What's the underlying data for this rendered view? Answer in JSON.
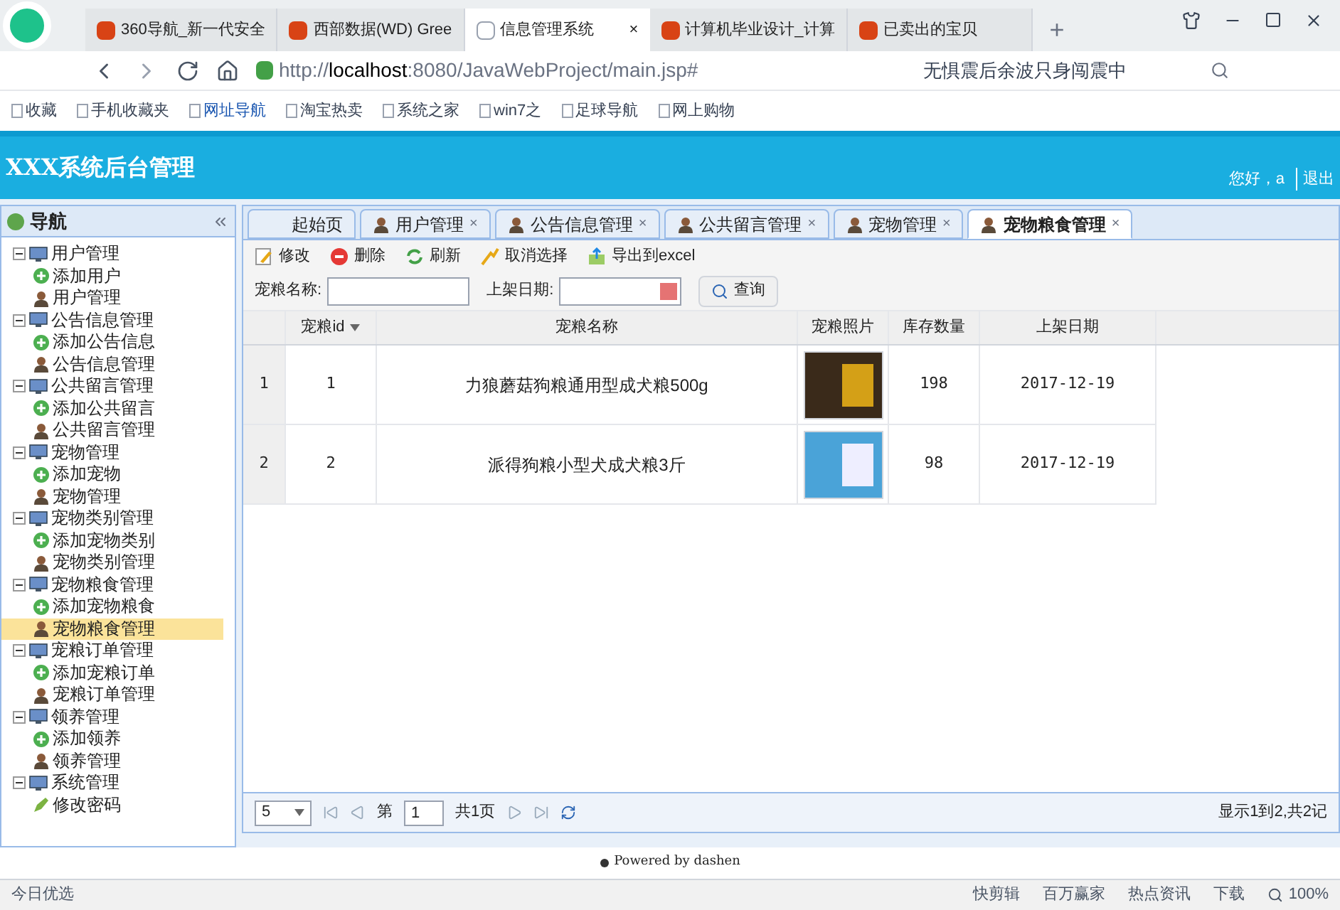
{
  "browser": {
    "tabs": [
      {
        "label": "360导航_新一代安全",
        "selected": false
      },
      {
        "label": "西部数据(WD) Gree",
        "selected": false
      },
      {
        "label": "信息管理系统",
        "selected": true,
        "close": "×"
      },
      {
        "label": "计算机毕业设计_计算",
        "selected": false
      },
      {
        "label": "已卖出的宝贝",
        "selected": false
      }
    ],
    "new_tab": "+",
    "url_host": "http://localhost",
    "url_rest": ":8080/JavaWebProject/main.jsp#",
    "search_hint": "无惧震后余波只身闯震中",
    "bookmarks": [
      "收藏",
      "手机收藏夹",
      "网址导航",
      "淘宝热卖",
      "系统之家",
      "win7之",
      "足球导航",
      "网上购物"
    ]
  },
  "app": {
    "title": "XXX系统后台管理",
    "greeting": "您好，a",
    "logout": "退出"
  },
  "sidebar": {
    "title": "导航",
    "items": [
      {
        "label": "用户管理",
        "children": [
          {
            "label": "添加用户",
            "kind": "add",
            "selected": false
          },
          {
            "label": "用户管理",
            "kind": "manage",
            "selected": false
          }
        ]
      },
      {
        "label": "公告信息管理",
        "children": [
          {
            "label": "添加公告信息",
            "kind": "add",
            "selected": false
          },
          {
            "label": "公告信息管理",
            "kind": "manage",
            "selected": false
          }
        ]
      },
      {
        "label": "公共留言管理",
        "children": [
          {
            "label": "添加公共留言",
            "kind": "add",
            "selected": false
          },
          {
            "label": "公共留言管理",
            "kind": "manage",
            "selected": false
          }
        ]
      },
      {
        "label": "宠物管理",
        "children": [
          {
            "label": "添加宠物",
            "kind": "add",
            "selected": false
          },
          {
            "label": "宠物管理",
            "kind": "manage",
            "selected": false
          }
        ]
      },
      {
        "label": "宠物类别管理",
        "children": [
          {
            "label": "添加宠物类别",
            "kind": "add",
            "selected": false
          },
          {
            "label": "宠物类别管理",
            "kind": "manage",
            "selected": false
          }
        ]
      },
      {
        "label": "宠物粮食管理",
        "children": [
          {
            "label": "添加宠物粮食",
            "kind": "add",
            "selected": false
          },
          {
            "label": "宠物粮食管理",
            "kind": "manage",
            "selected": true
          }
        ]
      },
      {
        "label": "宠粮订单管理",
        "children": [
          {
            "label": "添加宠粮订单",
            "kind": "add",
            "selected": false
          },
          {
            "label": "宠粮订单管理",
            "kind": "manage",
            "selected": false
          }
        ]
      },
      {
        "label": "领养管理",
        "children": [
          {
            "label": "添加领养",
            "kind": "add",
            "selected": false
          },
          {
            "label": "领养管理",
            "kind": "manage",
            "selected": false
          }
        ]
      },
      {
        "label": "系统管理",
        "children": [
          {
            "label": "修改密码",
            "kind": "edit",
            "selected": false
          }
        ]
      }
    ]
  },
  "tabs": [
    {
      "label": "起始页",
      "selected": false,
      "closable": false
    },
    {
      "label": "用户管理",
      "selected": false,
      "closable": true
    },
    {
      "label": "公告信息管理",
      "selected": false,
      "closable": true
    },
    {
      "label": "公共留言管理",
      "selected": false,
      "closable": true
    },
    {
      "label": "宠物管理",
      "selected": false,
      "closable": true
    },
    {
      "label": "宠物粮食管理",
      "selected": true,
      "closable": true
    }
  ],
  "tab_close": "×",
  "toolbar": [
    {
      "label": "修改",
      "kind": "edit"
    },
    {
      "label": "删除",
      "kind": "delete"
    },
    {
      "label": "刷新",
      "kind": "refresh"
    },
    {
      "label": "取消选择",
      "kind": "cancel"
    },
    {
      "label": "导出到excel",
      "kind": "export"
    }
  ],
  "filters": [
    {
      "label": "宠粮名称:",
      "kind": "text"
    },
    {
      "label": "上架日期:",
      "kind": "date"
    }
  ],
  "query_button": "查询",
  "table": {
    "columns": [
      "宠粮id",
      "宠粮名称",
      "宠粮照片",
      "库存数量",
      "上架日期"
    ],
    "rows": [
      {
        "row_number": "1",
        "id": "1",
        "name": "力狼蘑菇狗粮通用型成犬粮500g",
        "stock": "198",
        "date": "2017-12-19"
      },
      {
        "row_number": "2",
        "id": "2",
        "name": "派得狗粮小型犬成犬粮3斤",
        "stock": "98",
        "date": "2017-12-19"
      }
    ]
  },
  "pager": {
    "page_size": "5",
    "page_prefix": "第",
    "page": "1",
    "page_total": "共1页",
    "summary": "显示1到2,共2记"
  },
  "footer": "Powered by dashen",
  "statusbar": {
    "left": "今日优选",
    "items": [
      "快剪辑",
      "百万赢家",
      "热点资讯",
      "下载"
    ],
    "zoom": "100%"
  }
}
